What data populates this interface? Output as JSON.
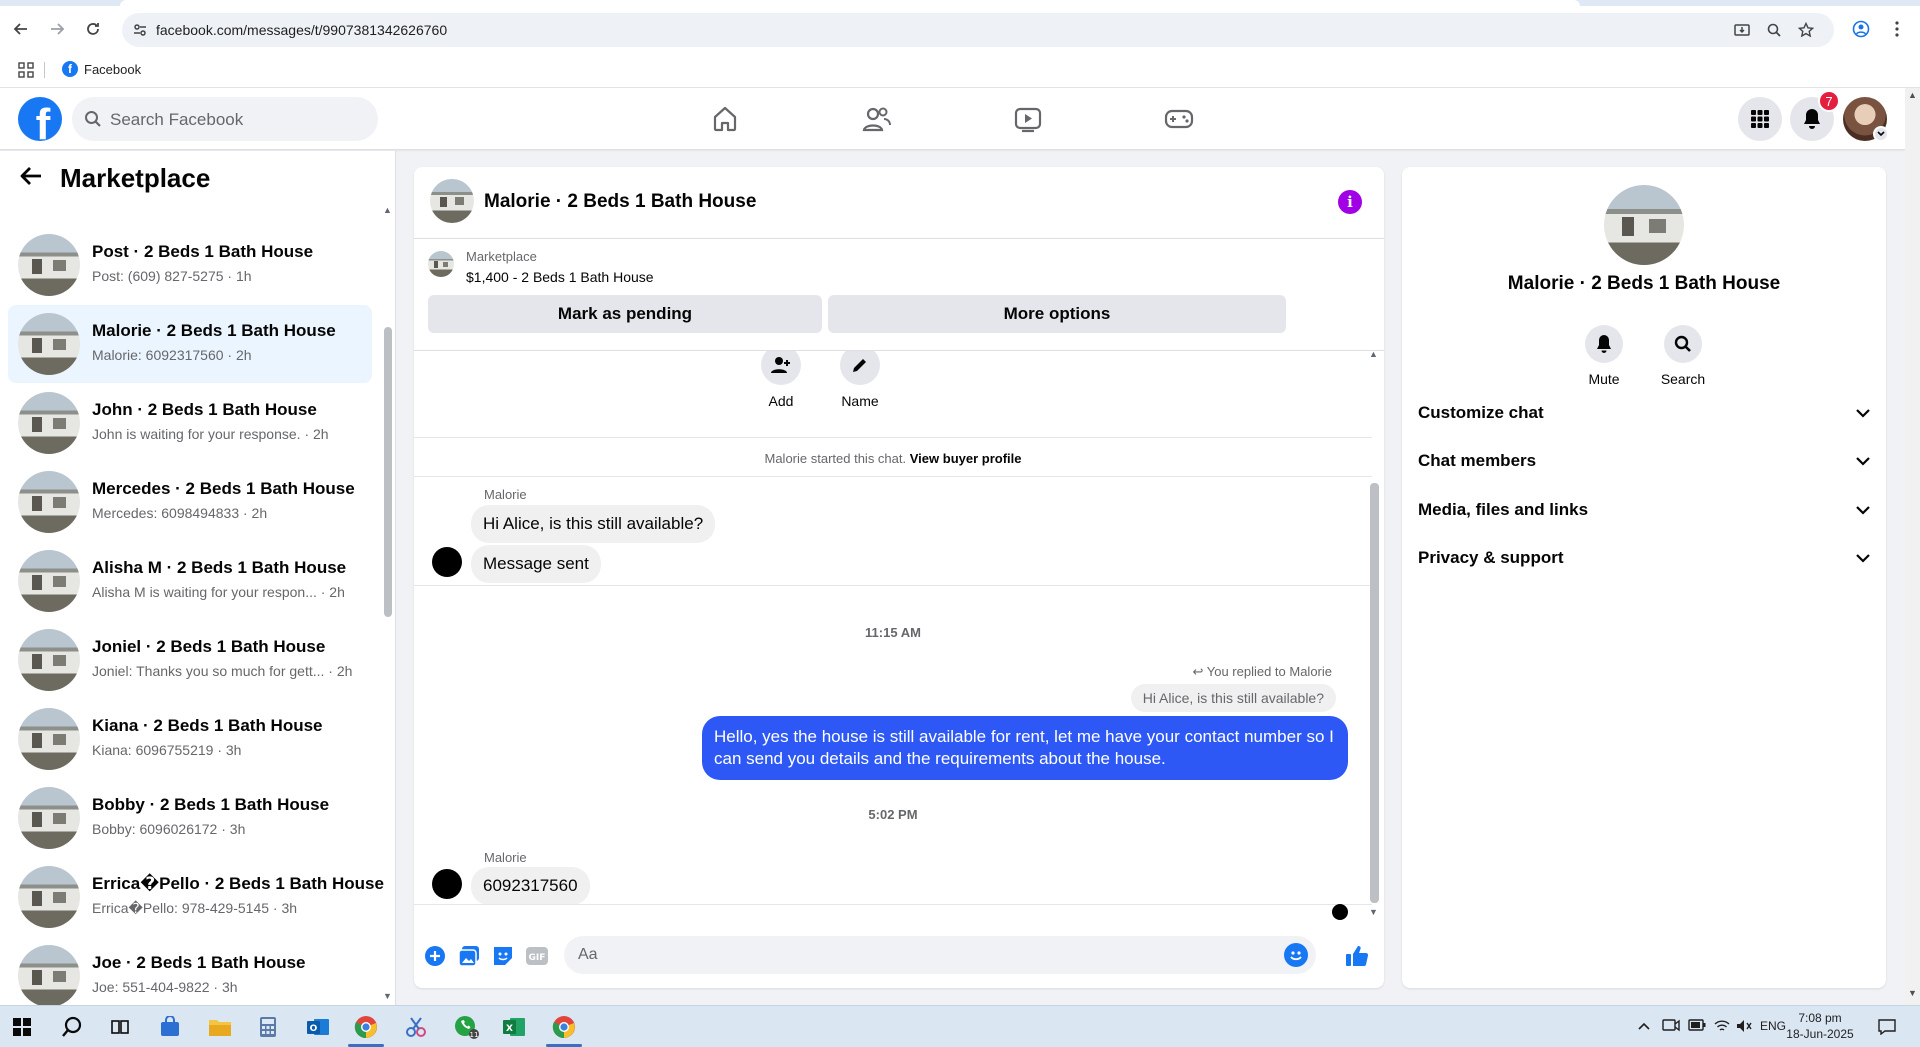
{
  "browser": {
    "url": "facebook.com/messages/t/9907381342626760",
    "bookmark": "Facebook",
    "bookmark_icon_letter": "f"
  },
  "header": {
    "logo_letter": "f",
    "search_placeholder": "Search Facebook",
    "notification_count": "7",
    "nav_icons": [
      "home-icon",
      "friends-icon",
      "video-icon",
      "gaming-icon"
    ]
  },
  "sidebar": {
    "title": "Marketplace",
    "conversations": [
      {
        "name": "Post · 2 Beds 1 Bath House",
        "preview": "Post: (609) 827-5275 · 1h"
      },
      {
        "name": "Malorie · 2 Beds 1 Bath House",
        "preview": "Malorie: 6092317560 · 2h"
      },
      {
        "name": "John · 2 Beds 1 Bath House",
        "preview": "John is waiting for your response. · 2h"
      },
      {
        "name": "Mercedes · 2 Beds 1 Bath House",
        "preview": "Mercedes: 6098494833 · 2h"
      },
      {
        "name": "Alisha M · 2 Beds 1 Bath House",
        "preview": "Alisha M is waiting for your respon...  · 2h"
      },
      {
        "name": "Joniel · 2 Beds 1 Bath House",
        "preview": "Joniel: Thanks you so much for gett...  · 2h"
      },
      {
        "name": "Kiana · 2 Beds 1 Bath House",
        "preview": "Kiana: 6096755219 · 3h"
      },
      {
        "name": "Bobby · 2 Beds 1 Bath House",
        "preview": "Bobby: 6096026172 · 3h"
      },
      {
        "name": "Errica�Pello · 2 Beds 1 Bath House",
        "preview": "Errica�Pello: 978-429-5145 · 3h"
      },
      {
        "name": "Joe · 2 Beds 1 Bath House",
        "preview": "Joe: 551-404-9822 · 3h"
      }
    ]
  },
  "chat": {
    "title": "Malorie · 2 Beds 1 Bath House",
    "marketplace_label": "Marketplace",
    "listing": "$1,400 - 2 Beds 1 Bath House",
    "mark_pending": "Mark as pending",
    "more_options": "More options",
    "actions": {
      "add": "Add",
      "name": "Name"
    },
    "started_text": "Malorie started this chat.",
    "view_profile": "View buyer profile",
    "messages": {
      "sender1": "Malorie",
      "msg1": "Hi Alice, is this still available?",
      "msg2": "Message sent",
      "time1": "11:15 AM",
      "replied_label": "You replied to Malorie",
      "quoted": "Hi Alice, is this still available?",
      "reply": "Hello, yes the house is still available for rent, let me have your contact number so I can send you details and the requirements about the house.",
      "time2": "5:02 PM",
      "sender2": "Malorie",
      "msg3": "6092317560"
    },
    "composer_placeholder": "Aa"
  },
  "details": {
    "name": "Malorie · 2 Beds 1 Bath House",
    "mute": "Mute",
    "search": "Search",
    "sections": [
      "Customize chat",
      "Chat members",
      "Media, files and links",
      "Privacy & support"
    ]
  },
  "taskbar": {
    "language": "ENG",
    "time": "7:08 pm",
    "date": "18-Jun-2025",
    "whatsapp_badge": "11"
  },
  "colors": {
    "accent": "#1877f2",
    "outgoing_bubble": "#2d58f5",
    "active_row": "#ebf5ff",
    "info_icon": "#a100e6",
    "badge": "#e41e3f"
  }
}
